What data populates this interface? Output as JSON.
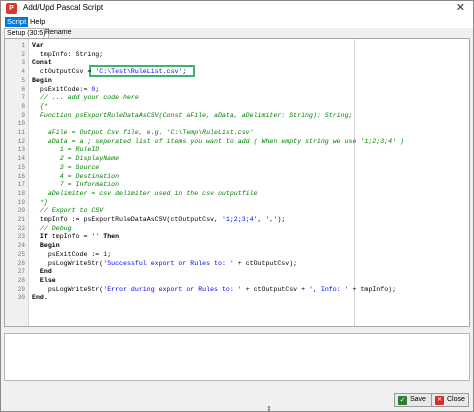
{
  "window": {
    "title": "Add/Upd Pascal Script",
    "app_icon_glyph": "P",
    "close_glyph": "✕"
  },
  "menu": {
    "items": [
      {
        "label": "Script",
        "active": true
      },
      {
        "label": "Help",
        "active": false
      }
    ]
  },
  "tabs": [
    {
      "label": "Setup (30:5)",
      "active": true
    },
    {
      "label": "Rename",
      "active": false
    }
  ],
  "editor": {
    "lines": [
      {
        "n": "1",
        "segs": [
          {
            "t": "Var",
            "c": "kw"
          }
        ]
      },
      {
        "n": "2",
        "segs": [
          {
            "t": "  tmpInfo: String;",
            "c": ""
          }
        ]
      },
      {
        "n": "3",
        "segs": [
          {
            "t": "Const",
            "c": "kw"
          }
        ]
      },
      {
        "n": "4",
        "segs": [
          {
            "t": "  ctOutputCsv = ",
            "c": ""
          },
          {
            "t": "'C:\\Test\\RuleList.csv'",
            "c": "str"
          },
          {
            "t": ";",
            "c": ""
          }
        ]
      },
      {
        "n": "5",
        "segs": [
          {
            "t": "Begin",
            "c": "kw"
          }
        ]
      },
      {
        "n": "6",
        "segs": [
          {
            "t": "  psExitCode:= ",
            "c": ""
          },
          {
            "t": "0",
            "c": "num"
          },
          {
            "t": ";",
            "c": ""
          }
        ]
      },
      {
        "n": "7",
        "segs": [
          {
            "t": "  // ... add your code here",
            "c": "cm"
          }
        ]
      },
      {
        "n": "8",
        "segs": [
          {
            "t": "  {*",
            "c": "cm"
          }
        ]
      },
      {
        "n": "9",
        "segs": [
          {
            "t": "  Function psExportRuleDataAsCSV(Const aFile, aData, aDelimiter: String): String;",
            "c": "cm"
          }
        ]
      },
      {
        "n": "10",
        "segs": [
          {
            "t": "",
            "c": ""
          }
        ]
      },
      {
        "n": "11",
        "segs": [
          {
            "t": "    aFile = Output Csv file, e.g. 'C:\\Temp\\RuleList.csv'",
            "c": "cm"
          }
        ]
      },
      {
        "n": "12",
        "segs": [
          {
            "t": "    aData = a ; seperated list of items you want to add ( When empty string we use '1;2;3;4' )",
            "c": "cm"
          }
        ]
      },
      {
        "n": "13",
        "segs": [
          {
            "t": "       1 = RuleID",
            "c": "cm"
          }
        ]
      },
      {
        "n": "14",
        "segs": [
          {
            "t": "       2 = DisplayName",
            "c": "cm"
          }
        ]
      },
      {
        "n": "15",
        "segs": [
          {
            "t": "       3 = Source",
            "c": "cm"
          }
        ]
      },
      {
        "n": "16",
        "segs": [
          {
            "t": "       4 = Destination",
            "c": "cm"
          }
        ]
      },
      {
        "n": "17",
        "segs": [
          {
            "t": "       7 = Information",
            "c": "cm"
          }
        ]
      },
      {
        "n": "18",
        "segs": [
          {
            "t": "    aDelimiter = csv delimiter used in the csv outputfile",
            "c": "cm"
          }
        ]
      },
      {
        "n": "19",
        "segs": [
          {
            "t": "  *}",
            "c": "cm"
          }
        ]
      },
      {
        "n": "20",
        "segs": [
          {
            "t": "  // Export to CSV",
            "c": "cm"
          }
        ]
      },
      {
        "n": "21",
        "segs": [
          {
            "t": "  tmpInfo := psExportRuleDataAsCSV(ctOutputCsv, ",
            "c": ""
          },
          {
            "t": "'1;2;3;4'",
            "c": "str"
          },
          {
            "t": ", ",
            "c": ""
          },
          {
            "t": "','",
            "c": "str"
          },
          {
            "t": ");",
            "c": ""
          }
        ]
      },
      {
        "n": "22",
        "segs": [
          {
            "t": "  // Debug",
            "c": "cm"
          }
        ]
      },
      {
        "n": "23",
        "segs": [
          {
            "t": "  If",
            "c": "kw"
          },
          {
            "t": " tmpInfo = ",
            "c": ""
          },
          {
            "t": "''",
            "c": "str"
          },
          {
            "t": " ",
            "c": ""
          },
          {
            "t": "Then",
            "c": "kw"
          }
        ]
      },
      {
        "n": "24",
        "segs": [
          {
            "t": "  Begin",
            "c": "kw"
          }
        ]
      },
      {
        "n": "25",
        "segs": [
          {
            "t": "    psExitCode := ",
            "c": ""
          },
          {
            "t": "1",
            "c": "num"
          },
          {
            "t": ";",
            "c": ""
          }
        ]
      },
      {
        "n": "26",
        "segs": [
          {
            "t": "    psLogWriteStr(",
            "c": ""
          },
          {
            "t": "'Successful export or Rules to: '",
            "c": "str"
          },
          {
            "t": " + ctOutputCsv);",
            "c": ""
          }
        ]
      },
      {
        "n": "27",
        "segs": [
          {
            "t": "  End",
            "c": "kw"
          }
        ]
      },
      {
        "n": "28",
        "segs": [
          {
            "t": "  Else",
            "c": "kw"
          }
        ]
      },
      {
        "n": "29",
        "segs": [
          {
            "t": "    psLogWriteStr(",
            "c": ""
          },
          {
            "t": "'Error during export or Rules to: '",
            "c": "str"
          },
          {
            "t": " + ctOutputCsv + ",
            "c": ""
          },
          {
            "t": "', Info: '",
            "c": "str"
          },
          {
            "t": " + tmpInfo);",
            "c": ""
          }
        ]
      },
      {
        "n": "30",
        "segs": [
          {
            "t": "End.",
            "c": "kw"
          }
        ]
      }
    ]
  },
  "buttons": {
    "save_label": "Save",
    "close_label": "Close"
  },
  "icons": {
    "save": "checkmark-icon",
    "close": "x-icon"
  }
}
